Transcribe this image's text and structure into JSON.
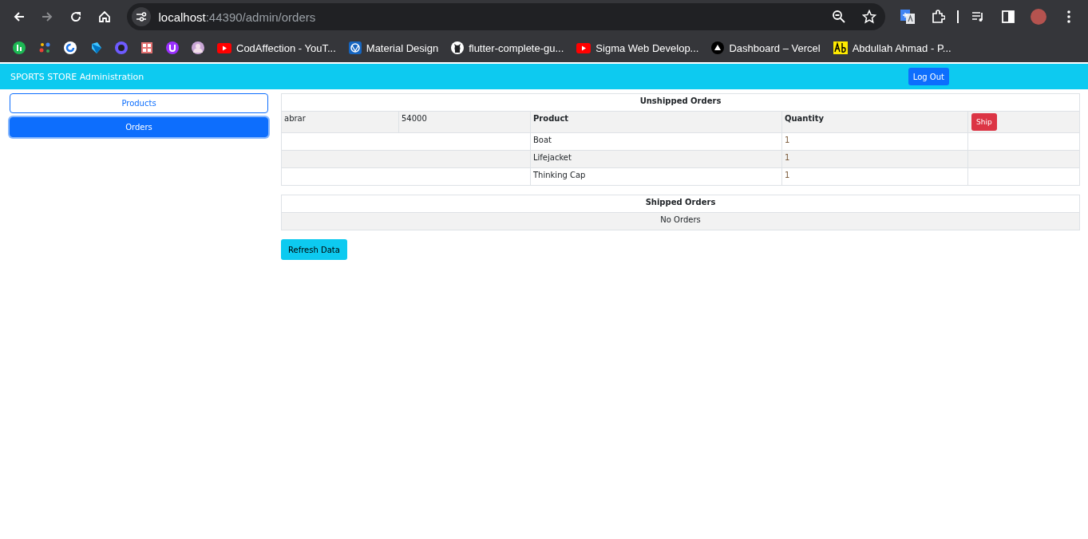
{
  "browser": {
    "url_host": "localhost",
    "url_rest": ":44390/admin/orders",
    "bookmarks": [
      {
        "kind": "green-badge"
      },
      {
        "kind": "dots"
      },
      {
        "kind": "c-circle"
      },
      {
        "kind": "dart"
      },
      {
        "kind": "purple-ring"
      },
      {
        "kind": "grid"
      },
      {
        "kind": "u-circle"
      },
      {
        "kind": "avatar"
      },
      {
        "kind": "video",
        "label": "CodAffection - YouT..."
      },
      {
        "kind": "blue-badge",
        "label": "Material Design"
      },
      {
        "kind": "octocat",
        "label": "flutter-complete-gu..."
      },
      {
        "kind": "video",
        "label": "Sigma Web Develop..."
      },
      {
        "kind": "triangle",
        "label": "Dashboard – Vercel"
      },
      {
        "kind": "ab",
        "label": "Abdullah Ahmad - P..."
      }
    ]
  },
  "header": {
    "title": "SPORTS STORE Administration",
    "logout": "Log Out"
  },
  "nav": [
    {
      "label": "Products",
      "selected": false
    },
    {
      "label": "Orders",
      "selected": true
    }
  ],
  "unshipped": {
    "title": "Unshipped Orders",
    "cells": [
      "abrar",
      "54000"
    ],
    "columns": [
      "Product",
      "Quantity"
    ],
    "ship_button": "Ship",
    "lines": [
      {
        "product": "Boat",
        "quantity": "1"
      },
      {
        "product": "Lifejacket",
        "quantity": "1"
      },
      {
        "product": "Thinking Cap",
        "quantity": "1"
      }
    ]
  },
  "shipped": {
    "title": "Shipped Orders",
    "empty_text": "No Orders"
  },
  "refresh_button": "Refresh Data"
}
